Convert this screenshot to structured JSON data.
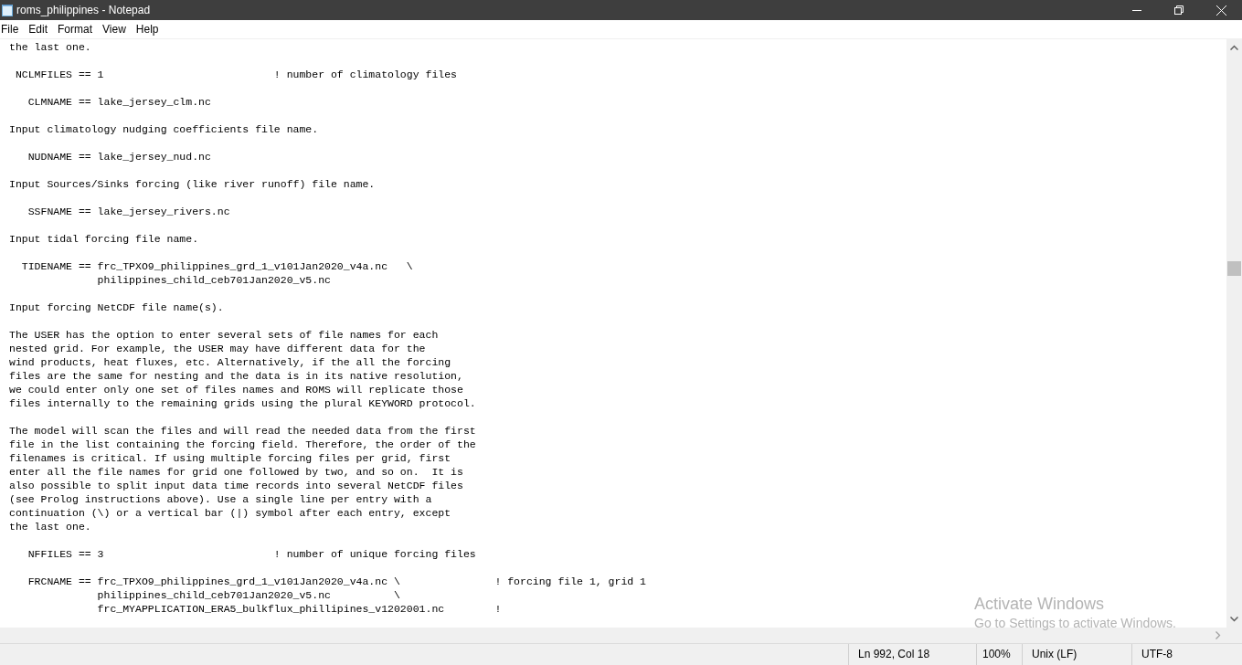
{
  "window": {
    "title": "roms_philippines - Notepad"
  },
  "menu": [
    "File",
    "Edit",
    "Format",
    "View",
    "Help"
  ],
  "editor": {
    "blocks": [
      [
        "the last one."
      ],
      [
        " NCLMFILES == 1                           ! number of climatology files"
      ],
      [
        "   CLMNAME == lake_jersey_clm.nc"
      ],
      [
        "Input climatology nudging coefficients file name."
      ],
      [
        "   NUDNAME == lake_jersey_nud.nc"
      ],
      [
        "Input Sources/Sinks forcing (like river runoff) file name."
      ],
      [
        "   SSFNAME == lake_jersey_rivers.nc"
      ],
      [
        "Input tidal forcing file name."
      ],
      [
        "  TIDENAME == frc_TPXO9_philippines_grd_1_v101Jan2020_v4a.nc   \\",
        "              philippines_child_ceb701Jan2020_v5.nc"
      ],
      [
        "Input forcing NetCDF file name(s)."
      ],
      [
        "The USER has the option to enter several sets of file names for each",
        "nested grid. For example, the USER may have different data for the",
        "wind products, heat fluxes, etc. Alternatively, if the all the forcing",
        "files are the same for nesting and the data is in its native resolution,",
        "we could enter only one set of files names and ROMS will replicate those",
        "files internally to the remaining grids using the plural KEYWORD protocol."
      ],
      [
        "The model will scan the files and will read the needed data from the first",
        "file in the list containing the forcing field. Therefore, the order of the",
        "filenames is critical. If using multiple forcing files per grid, first",
        "enter all the file names for grid one followed by two, and so on.  It is",
        "also possible to split input data time records into several NetCDF files",
        "(see Prolog instructions above). Use a single line per entry with a",
        "continuation (\\) or a vertical bar (|) symbol after each entry, except",
        "the last one."
      ],
      [
        "   NFFILES == 3                           ! number of unique forcing files"
      ],
      [
        "   FRCNAME == frc_TPXO9_philippines_grd_1_v101Jan2020_v4a.nc \\               ! forcing file 1, grid 1",
        "              philippines_child_ceb701Jan2020_v5.nc          \\",
        "              frc_MYAPPLICATION_ERA5_bulkflux_phillipines_v1202001.nc        !"
      ]
    ]
  },
  "status_bar": [
    "Ln 992, Col 18",
    "100%",
    "Unix (LF)",
    "UTF-8"
  ],
  "os_notice": {
    "title": "Activate Windows",
    "subtitle": "Go to Settings to activate Windows."
  }
}
